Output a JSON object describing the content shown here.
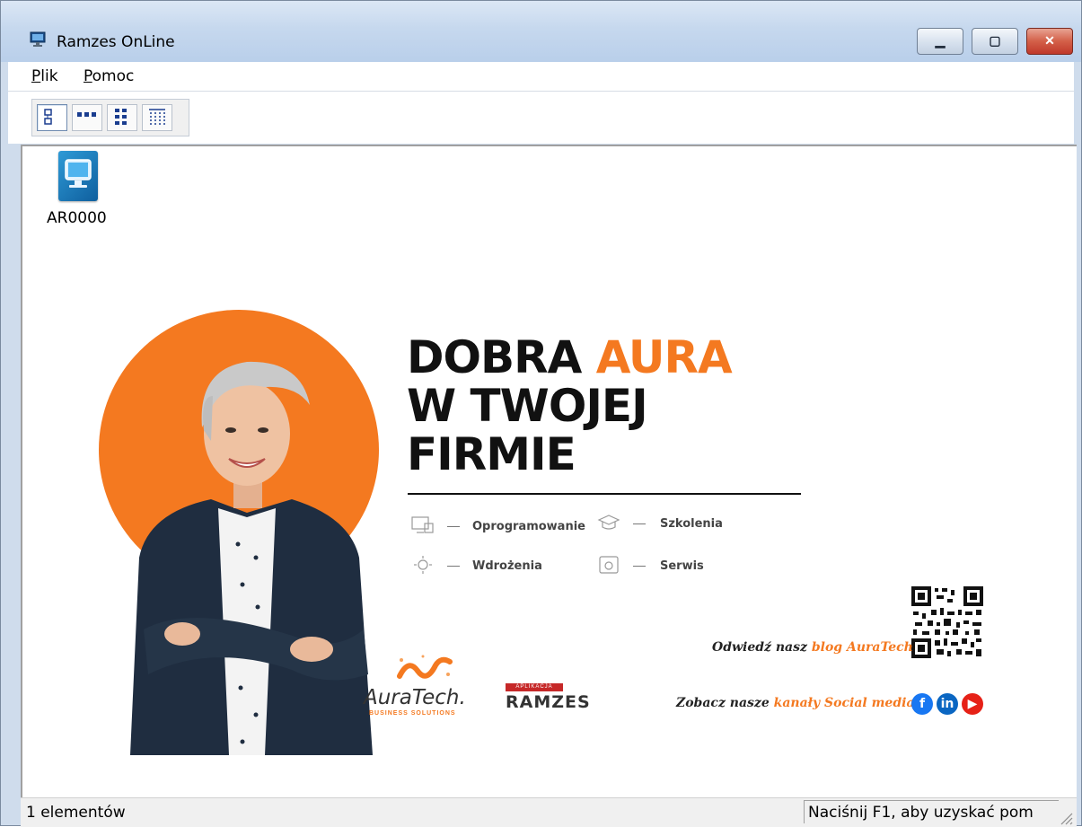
{
  "window": {
    "title": "Ramzes OnLine"
  },
  "menu": {
    "items": [
      {
        "label": "Plik",
        "accel": "P",
        "rest": "lik"
      },
      {
        "label": "Pomoc",
        "accel": "P",
        "rest": "omoc"
      }
    ]
  },
  "toolbar": {
    "views": [
      "large-icons",
      "small-icons",
      "list",
      "details"
    ]
  },
  "content": {
    "items": [
      {
        "label": "AR0000",
        "icon": "computer-monitor-icon"
      }
    ],
    "banner": {
      "headline": {
        "line1_prefix": "DOBRA ",
        "line1_accent": "AURA",
        "line2": "W TWOJEJ",
        "line3": "FIRMIE"
      },
      "services": [
        "Oprogramowanie",
        "Szkolenia",
        "Wdrożenia",
        "Serwis"
      ],
      "blog": {
        "prefix": "Odwiedź nasz ",
        "accent": "blog AuraTech"
      },
      "social": {
        "prefix": "Zobacz nasze ",
        "accent": "kanały Social media"
      },
      "logos": {
        "auratech": "AuraTech.",
        "auratech_sub": "BUSINESS SOLUTIONS",
        "ramzes_tag": "APLIKACJA",
        "ramzes": "RAMZES"
      },
      "colors": {
        "accent": "#f47920",
        "dark": "#111111"
      }
    }
  },
  "status": {
    "left": "1 elementów",
    "right": "Naciśnij F1, aby uzyskać pom"
  }
}
